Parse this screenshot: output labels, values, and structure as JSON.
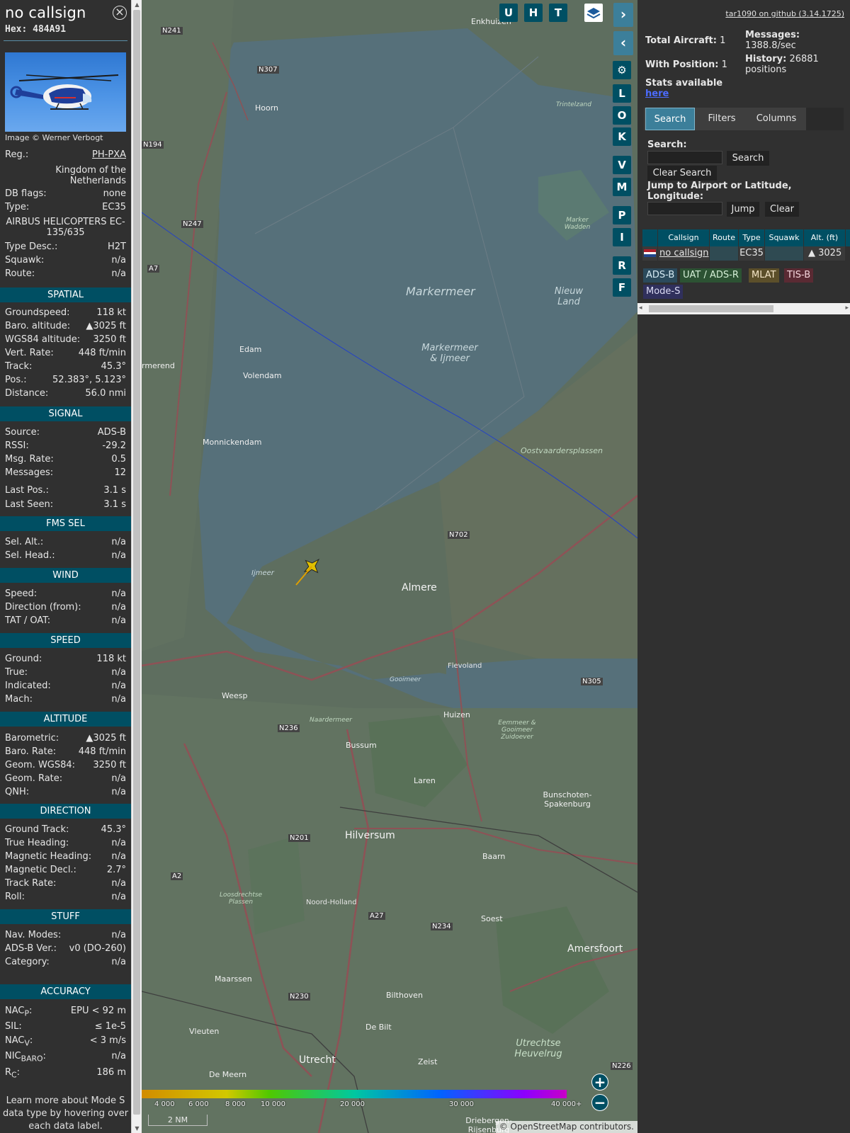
{
  "detail": {
    "callsign": "no callsign",
    "hex_label": "Hex:",
    "hex_value": "484A91",
    "photo_credit": "Image © Werner Verbogt",
    "reg": {
      "label": "Reg.:",
      "value": "PH-PXA"
    },
    "country_line1": "Kingdom of the",
    "country_line2": "Netherlands",
    "db_flags": {
      "label": "DB flags:",
      "value": "none"
    },
    "type": {
      "label": "Type:",
      "value": "EC35"
    },
    "type_full_line1": "AIRBUS HELICOPTERS EC-",
    "type_full_line2": "135/635",
    "type_desc": {
      "label": "Type Desc.:",
      "value": "H2T"
    },
    "squawk": {
      "label": "Squawk:",
      "value": "n/a"
    },
    "route": {
      "label": "Route:",
      "value": "n/a"
    }
  },
  "sections": {
    "spatial": "SPATIAL",
    "signal": "SIGNAL",
    "fms_sel": "FMS SEL",
    "wind": "WIND",
    "speed": "SPEED",
    "altitude": "ALTITUDE",
    "direction": "DIRECTION",
    "stuff": "STUFF",
    "accuracy": "ACCURACY"
  },
  "spatial": [
    {
      "label": "Groundspeed:",
      "value": "118 kt"
    },
    {
      "label": "Baro. altitude:",
      "value": "▲3025 ft"
    },
    {
      "label": "WGS84 altitude:",
      "value": "3250 ft"
    },
    {
      "label": "Vert. Rate:",
      "value": "448 ft/min"
    },
    {
      "label": "Track:",
      "value": "45.3°"
    },
    {
      "label": "Pos.:",
      "value": "52.383°, 5.123°"
    },
    {
      "label": "Distance:",
      "value": "56.0 nmi"
    }
  ],
  "signal": [
    {
      "label": "Source:",
      "value": "ADS-B"
    },
    {
      "label": "RSSI:",
      "value": "-29.2"
    },
    {
      "label": "Msg. Rate:",
      "value": "0.5"
    },
    {
      "label": "Messages:",
      "value": "12"
    },
    {
      "label": "Last Pos.:",
      "value": "3.1 s"
    },
    {
      "label": "Last Seen:",
      "value": "3.1 s"
    }
  ],
  "fms_sel": [
    {
      "label": "Sel. Alt.:",
      "value": "n/a"
    },
    {
      "label": "Sel. Head.:",
      "value": "n/a"
    }
  ],
  "wind": [
    {
      "label": "Speed:",
      "value": "n/a"
    },
    {
      "label": "Direction (from):",
      "value": "n/a"
    },
    {
      "label": "TAT / OAT:",
      "value": "n/a"
    }
  ],
  "speed": [
    {
      "label": "Ground:",
      "value": "118 kt"
    },
    {
      "label": "True:",
      "value": "n/a"
    },
    {
      "label": "Indicated:",
      "value": "n/a"
    },
    {
      "label": "Mach:",
      "value": "n/a"
    }
  ],
  "altitude": [
    {
      "label": "Barometric:",
      "value": "▲3025 ft"
    },
    {
      "label": "Baro. Rate:",
      "value": "448 ft/min"
    },
    {
      "label": "Geom. WGS84:",
      "value": "3250 ft"
    },
    {
      "label": "Geom. Rate:",
      "value": "n/a"
    },
    {
      "label": "QNH:",
      "value": "n/a"
    }
  ],
  "direction": [
    {
      "label": "Ground Track:",
      "value": "45.3°"
    },
    {
      "label": "True Heading:",
      "value": "n/a"
    },
    {
      "label": "Magnetic Heading:",
      "value": "n/a"
    },
    {
      "label": "Magnetic Decl.:",
      "value": "2.7°"
    },
    {
      "label": "Track Rate:",
      "value": "n/a"
    },
    {
      "label": "Roll:",
      "value": "n/a"
    }
  ],
  "stuff": [
    {
      "label": "Nav. Modes:",
      "value": "n/a"
    },
    {
      "label": "ADS-B Ver.:",
      "value": "v0 (DO-260)"
    },
    {
      "label": "Category:",
      "value": "n/a"
    }
  ],
  "accuracy": {
    "nacp": {
      "label": "NAC",
      "sub": "P",
      "value": "EPU < 92 m"
    },
    "sil": {
      "label": "SIL:",
      "value": "≤ 1e-5"
    },
    "nacv": {
      "label": "NAC",
      "sub": "V",
      "value": "< 3 m/s"
    },
    "nicbaro": {
      "label": "NIC",
      "sub": "BARO",
      "value": "n/a"
    },
    "rc": {
      "label": "R",
      "sub": "C",
      "value": "186 m"
    }
  },
  "learn_more": [
    "Learn more about Mode S",
    "data type by hovering over",
    "each data label."
  ],
  "map": {
    "top_buttons": [
      "U",
      "H",
      "T"
    ],
    "side_buttons": [
      "L",
      "O",
      "K",
      "V",
      "M",
      "P",
      "I",
      "R",
      "F"
    ],
    "zoom_in": "+",
    "zoom_out": "−",
    "scale": "2 NM",
    "attribution_a": "© ",
    "attribution_link": "OpenStreetMap",
    "attribution_b": " contributors.",
    "altitude_labels": [
      "4 000",
      "6 000",
      "8 000",
      "10 000",
      "20 000",
      "30 000",
      "40 000+"
    ],
    "places": [
      "Enkhuizen",
      "Hoorn",
      "Markermeer",
      "Markermeer & Ijmeer",
      "Nieuw Land",
      "Edam",
      "Volendam",
      "Monnickendam",
      "Oostvaardersplassen",
      "Almere",
      "Weesp",
      "Huizen",
      "Bussum",
      "Laren",
      "Hilversum",
      "Baarn",
      "Soest",
      "Bunschoten-Spakenburg",
      "Amersfoort",
      "Maarssen",
      "Bilthoven",
      "De Bilt",
      "Utrecht",
      "Zeist",
      "Utrechtse Heuvelrug",
      "Vleuten",
      "De Meern",
      "Trintelzand",
      "Marker Wadden",
      "Ijmeer",
      "Gooimeer",
      "Flevoland",
      "Naardermeer",
      "Loosdrechtse Plassen",
      "Noord-Holland",
      "Eemmeer & Gooimeer Zuidoever",
      "Driebergen-Rijsenburg",
      "rmerend"
    ],
    "roads": [
      "N241",
      "N307",
      "N194",
      "N247",
      "A7",
      "N702",
      "N236",
      "N201",
      "A2",
      "A27",
      "N234",
      "N230",
      "N305",
      "N226"
    ]
  },
  "right": {
    "github_link": "tar1090 on github (3.14.1725)",
    "total_aircraft_label": "Total Aircraft:",
    "total_aircraft_value": "1",
    "with_position_label": "With Position:",
    "with_position_value": "1",
    "stats_label": "Stats available",
    "stats_link": "here",
    "messages_label": "Messages:",
    "messages_value": "1388.8/sec",
    "history_label": "History:",
    "history_value": "26881",
    "history_unit": "positions",
    "tabs": [
      "Search",
      "Filters",
      "Columns"
    ],
    "search_label": "Search:",
    "search_button": "Search",
    "clear_search_button": "Clear Search",
    "jump_label_line1": "Jump to Airport or Latitude,",
    "jump_label_line2": "Longitude:",
    "jump_button": "Jump",
    "clear_button": "Clear",
    "columns": [
      "Callsign",
      "Route",
      "Type",
      "Squawk",
      "Alt. (ft)"
    ],
    "row": {
      "callsign": "no callsign",
      "route": "",
      "type": "EC35",
      "squawk": "",
      "alt": "▲ 3025"
    },
    "sources": [
      {
        "label": "ADS-B",
        "bg": "#2b4a5c",
        "fg": "#d8ecf5"
      },
      {
        "label": "UAT / ADS-R",
        "bg": "#2c5233",
        "fg": "#d6f0d8"
      },
      {
        "label": "MLAT",
        "bg": "#5c4f2a",
        "fg": "#f5e6c8"
      },
      {
        "label": "TIS-B",
        "bg": "#5a2a33",
        "fg": "#f5d6dc"
      },
      {
        "label": "Mode-S",
        "bg": "#30305c",
        "fg": "#dcdcf5"
      }
    ]
  },
  "colors": {
    "accent": "#004f63",
    "accent_active": "#3c7f9a",
    "panel_bg": "#303030"
  }
}
